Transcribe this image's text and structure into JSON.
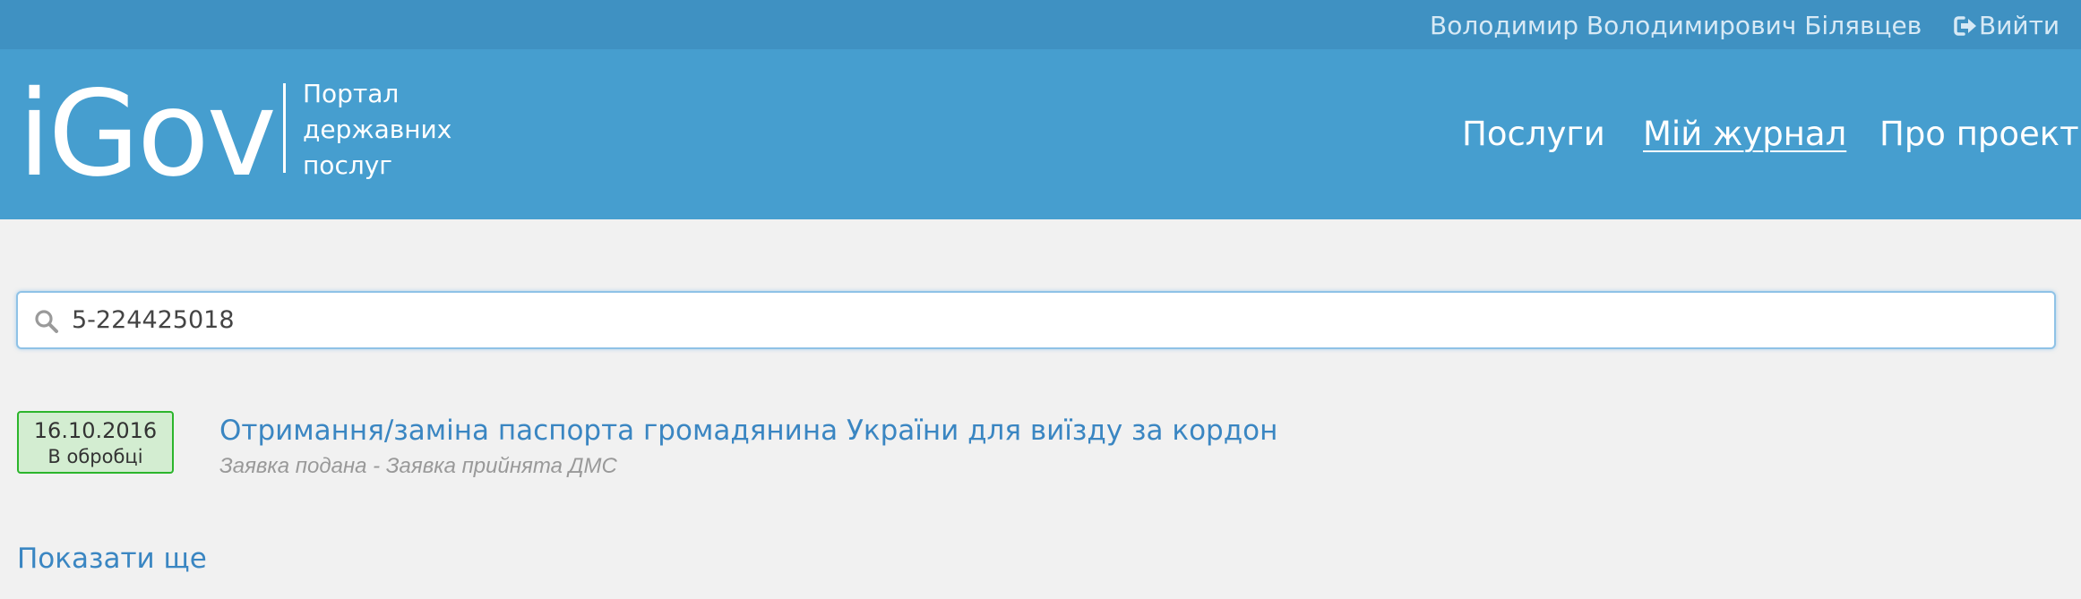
{
  "topbar": {
    "user_name": "Володимир Володимирович Білявцев",
    "logout_label": "Вийти",
    "logout_icon": "sign-out-icon"
  },
  "header": {
    "logo": "iGov",
    "portal_title": "Портал державних послуг",
    "nav": [
      {
        "label": "Послуги",
        "active": false
      },
      {
        "label": "Мій журнал",
        "active": true
      },
      {
        "label": "Про проект",
        "active": false
      }
    ]
  },
  "search": {
    "icon": "search-icon",
    "value": "5-224425018"
  },
  "results": [
    {
      "date": "16.10.2016",
      "status_badge": "В обробці",
      "title": "Отримання/заміна паспорта громадянина України для виїзду за кордон",
      "status_text": "Заявка подана - Заявка прийнята ДМС"
    }
  ],
  "show_more_label": "Показати ще",
  "colors": {
    "topbar_bg": "#3f91c2",
    "header_bg": "#469ecf",
    "page_bg": "#f1f1f1",
    "link": "#3a86c2",
    "badge_bg": "#d3edd1",
    "badge_border": "#2cb52c"
  }
}
